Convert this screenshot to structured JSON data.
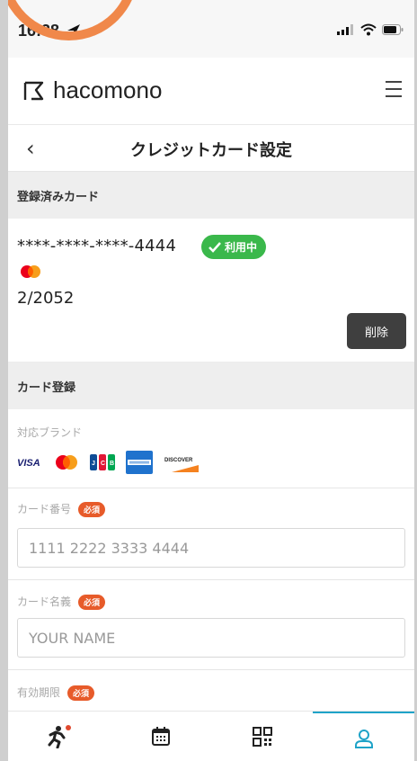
{
  "status": {
    "time": "16:38"
  },
  "app": {
    "brand": "hacomono"
  },
  "page": {
    "title": "クレジットカード設定"
  },
  "registered": {
    "heading": "登録済みカード",
    "card_number": "****-****-****-4444",
    "in_use_label": "利用中",
    "expiry": "2/2052",
    "delete_label": "削除"
  },
  "register": {
    "heading": "カード登録",
    "brands_label": "対応ブランド",
    "brands": [
      "VISA",
      "Mastercard",
      "JCB",
      "American Express",
      "DISCOVER"
    ],
    "card_number_label": "カード番号",
    "card_number_placeholder": "1111 2222 3333 4444",
    "card_name_label": "カード名義",
    "card_name_placeholder": "YOUR NAME",
    "expiry_label": "有効期限",
    "required_label": "必須"
  },
  "tabs": [
    {
      "icon": "runner-icon",
      "active": false
    },
    {
      "icon": "calendar-icon",
      "active": false
    },
    {
      "icon": "qr-icon",
      "active": false
    },
    {
      "icon": "user-icon",
      "active": true
    }
  ],
  "colors": {
    "accent": "#1fa3c8",
    "in_use_green": "#3ab84b",
    "required_red": "#e75b2a",
    "notify_dot": "#e04a2f"
  }
}
